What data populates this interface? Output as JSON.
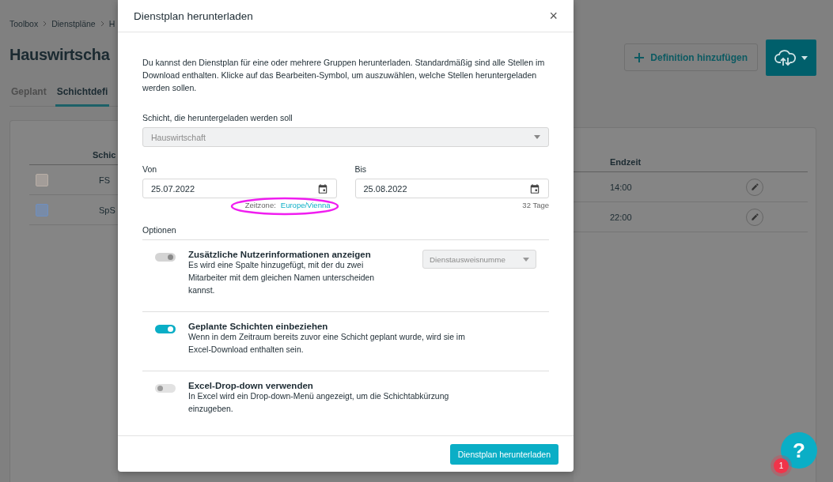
{
  "breadcrumb": [
    "Toolbox",
    "Dienstpläne",
    "H"
  ],
  "page_title": "Hauswirtscha",
  "tabs": [
    {
      "label": "Geplant",
      "selected": false
    },
    {
      "label": "Schichtdefi",
      "selected": true
    }
  ],
  "actions": {
    "add_button": "Definition hinzufügen"
  },
  "table": {
    "columns": [
      "Schic",
      "Endzeit"
    ],
    "rows": [
      {
        "color": "#b8aea6",
        "name": "FS",
        "end": "14:00"
      },
      {
        "color": "#6f8fc0",
        "name": "SpS",
        "end": "22:00"
      }
    ]
  },
  "dialog": {
    "title": "Dienstplan herunterladen",
    "close": "×",
    "intro": "Du kannst den Dienstplan für eine oder mehrere Gruppen herunterladen. Standardmäßig sind alle Stellen im Download enthalten. Klicke auf das Bearbeiten-Symbol, um auszuwählen, welche Stellen heruntergeladen werden sollen.",
    "shift_label": "Schicht, die heruntergeladen werden soll",
    "shift_value": "Hauswirtschaft",
    "from": {
      "label": "Von",
      "value": "25.07.2022",
      "timezone_label": "Zeitzone:",
      "timezone": "Europe/Vienna"
    },
    "to": {
      "label": "Bis",
      "value": "25.08.2022",
      "days": "32 Tage"
    },
    "options_label": "Optionen",
    "options": [
      {
        "title": "Zusätzliche Nutzerinformationen anzeigen",
        "text": "Es wird eine Spalte hinzugefügt, mit der du zwei Mitarbeiter mit dem gleichen Namen unterscheiden kannst.",
        "on": true,
        "disabled": true,
        "select": "Dienstausweisnumme"
      },
      {
        "title": "Geplante Schichten einbeziehen",
        "text": "Wenn in dem Zeitraum bereits zuvor eine Schicht geplant wurde, wird sie im Excel-Download enthalten sein.",
        "on": true,
        "disabled": false
      },
      {
        "title": "Excel-Drop-down verwenden",
        "text": "In Excel wird ein Drop-down-Menü angezeigt, um die Schichtabkürzung einzugeben.",
        "on": false,
        "disabled": false
      }
    ],
    "submit": "Dienstplan herunterladen"
  },
  "help": {
    "label": "?",
    "badge": "1"
  }
}
